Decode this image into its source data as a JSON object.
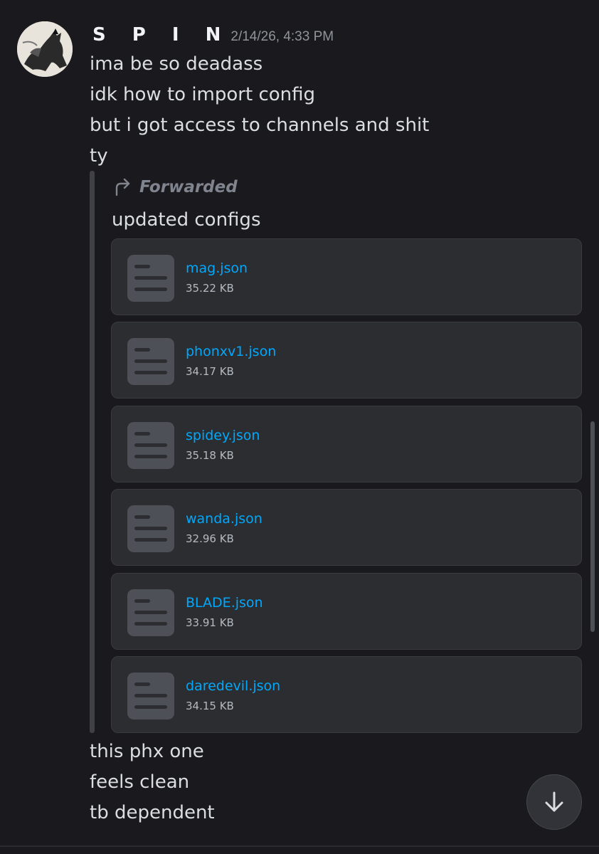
{
  "message": {
    "author": "S P I N",
    "timestamp": "2/14/26, 4:33 PM",
    "lines_before": [
      "ima be so deadass",
      "idk how to import config",
      "but i got access to channels and shit",
      "ty"
    ],
    "forward": {
      "label": "Forwarded",
      "icon": "forward-arrow-icon",
      "text": "updated configs",
      "attachments": [
        {
          "name": "mag.json",
          "size": "35.22 KB"
        },
        {
          "name": "phonxv1.json",
          "size": "34.17 KB"
        },
        {
          "name": "spidey.json",
          "size": "35.18 KB"
        },
        {
          "name": "wanda.json",
          "size": "32.96 KB"
        },
        {
          "name": "BLADE.json",
          "size": "33.91 KB"
        },
        {
          "name": "daredevil.json",
          "size": "34.15 KB"
        }
      ]
    },
    "lines_after": [
      "this phx one",
      "feels clean",
      "tb dependent"
    ]
  },
  "ui": {
    "jump_button_icon": "arrow-down-icon",
    "file_icon": "document-icon"
  },
  "colors": {
    "background": "#1a1a1e",
    "card": "#2b2d31",
    "link": "#00a8fc",
    "text": "#dbdee1",
    "muted": "#80848e"
  }
}
